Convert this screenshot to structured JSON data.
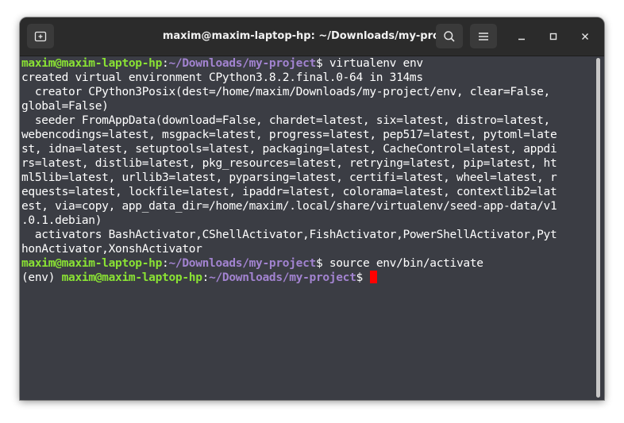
{
  "window": {
    "title": "maxim@maxim-laptop-hp: ~/Downloads/my-project",
    "new_tab_icon": "new-tab-icon",
    "search_icon": "search-icon",
    "menu_icon": "hamburger-menu-icon",
    "minimize_icon": "minimize-icon",
    "maximize_icon": "maximize-icon",
    "close_icon": "close-icon"
  },
  "terminal": {
    "prompt_user": "maxim@maxim-laptop-hp",
    "prompt_sep": ":",
    "prompt_path": "~/Downloads/my-project",
    "prompt_end": "$ ",
    "venv_prefix": "(env) ",
    "cmd1": "virtualenv env",
    "output": [
      "created virtual environment CPython3.8.2.final.0-64 in 314ms",
      "  creator CPython3Posix(dest=/home/maxim/Downloads/my-project/env, clear=False,",
      "global=False)",
      "  seeder FromAppData(download=False, chardet=latest, six=latest, distro=latest,",
      "webencodings=latest, msgpack=latest, progress=latest, pep517=latest, pytoml=late",
      "st, idna=latest, setuptools=latest, packaging=latest, CacheControl=latest, appdi",
      "rs=latest, distlib=latest, pkg_resources=latest, retrying=latest, pip=latest, ht",
      "ml5lib=latest, urllib3=latest, pyparsing=latest, certifi=latest, wheel=latest, r",
      "equests=latest, lockfile=latest, ipaddr=latest, colorama=latest, contextlib2=lat",
      "est, via=copy, app_data_dir=/home/maxim/.local/share/virtualenv/seed-app-data/v1",
      ".0.1.debian)",
      "  activators BashActivator,CShellActivator,FishActivator,PowerShellActivator,Pyt",
      "honActivator,XonshActivator"
    ],
    "cmd2": "source env/bin/activate"
  },
  "colors": {
    "user": "#8ae234",
    "path": "#a283d0",
    "background": "#3b3d44",
    "cursor": "#ff0000"
  }
}
